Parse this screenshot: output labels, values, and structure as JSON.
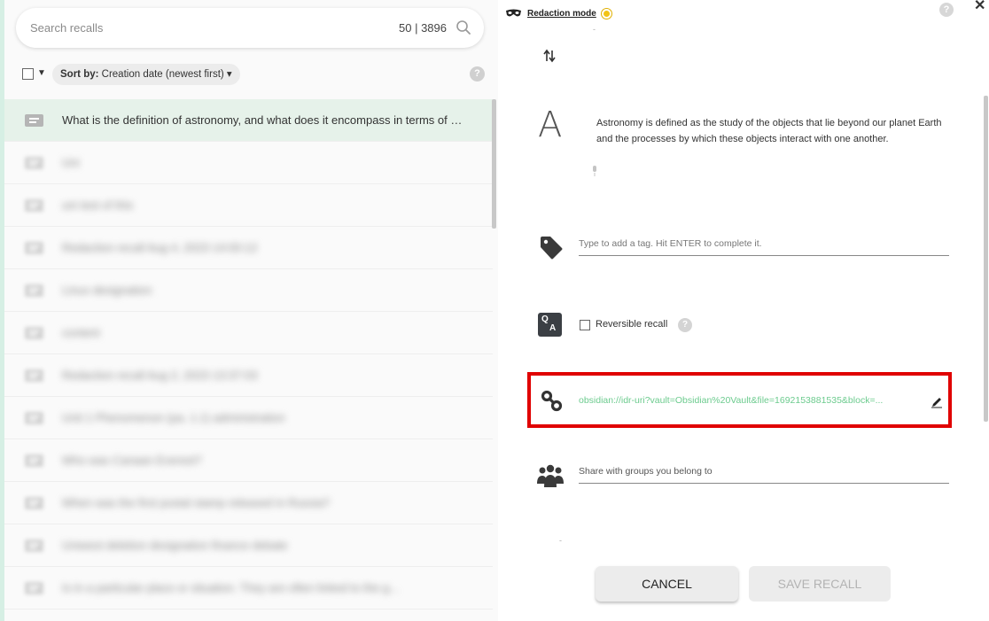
{
  "search": {
    "placeholder": "Search recalls",
    "count": "50 | 3896"
  },
  "toolbar": {
    "sort_label": "Sort by:",
    "sort_value": "Creation date (newest first)"
  },
  "list": {
    "items": [
      {
        "text": "What is the definition of astronomy, and what does it encompass in terms of study?",
        "selected": true
      },
      {
        "text": "Uni",
        "selected": false
      },
      {
        "text": "uni test of this",
        "selected": false
      },
      {
        "text": "Redaction recall Aug 4, 2023 14:00:12",
        "selected": false
      },
      {
        "text": "Linux designation",
        "selected": false
      },
      {
        "text": "content",
        "selected": false
      },
      {
        "text": "Redaction recall Aug 2, 2023 13:37:03",
        "selected": false
      },
      {
        "text": "Unit 1 Phenomenon (pa. 1.1) administration",
        "selected": false
      },
      {
        "text": "Who was Canaan Everest?",
        "selected": false
      },
      {
        "text": "When was the first postal stamp released in Russia?",
        "selected": false
      },
      {
        "text": "Uniwest deletion designation finance debate",
        "selected": false
      },
      {
        "text": "Is in a particular place or situation. They are often linked to the g...",
        "selected": false
      }
    ]
  },
  "detail": {
    "redaction_label": "Redaction mode",
    "help": "?",
    "close": "✕",
    "answer_letter": "A",
    "answer_text": "Astronomy is defined as the study of the objects that lie beyond our planet Earth and the processes by which these objects interact with one another.",
    "tag_placeholder": "Type to add a tag. Hit ENTER to complete it.",
    "qa_q": "Q",
    "qa_a": "A",
    "reversible_label": "Reversible recall",
    "link_url": "obsidian://idr-uri?vault=Obsidian%20Vault&file=1692153881535&block=...",
    "groups_placeholder": "Share with groups you belong to",
    "cancel_label": "CANCEL",
    "save_label": "SAVE RECALL"
  },
  "colors": {
    "accent_green": "#6ccb8e",
    "highlight_red": "#e00000",
    "selected_row": "#e6f2ea",
    "redaction_dot": "#f2c316"
  },
  "icons": [
    "search-icon",
    "mask-icon",
    "swap-icon",
    "microphone-icon",
    "tag-icon",
    "qa-icon",
    "link-icon",
    "pencil-icon",
    "groups-icon",
    "recall-card-icon"
  ]
}
